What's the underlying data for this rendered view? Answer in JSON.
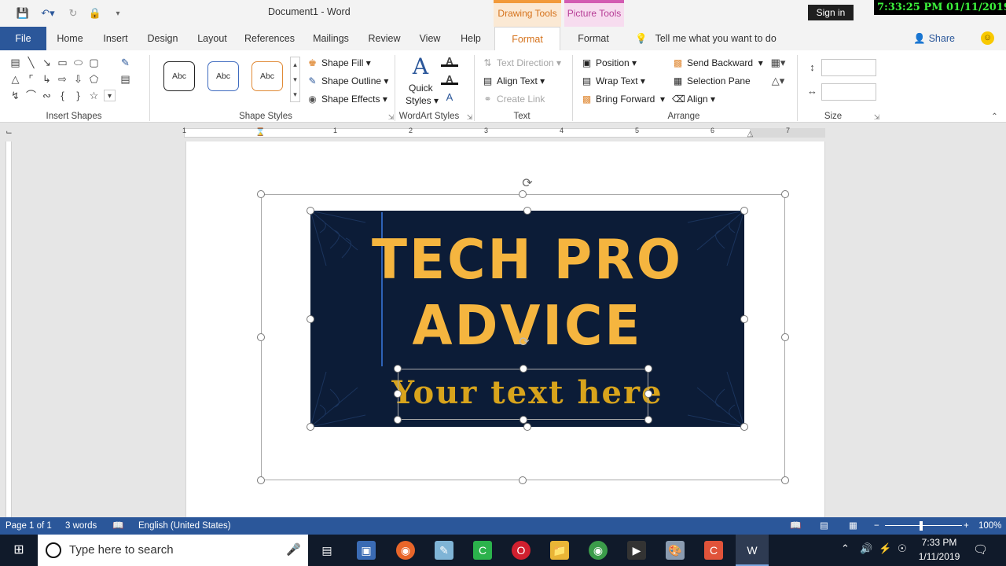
{
  "window": {
    "doc_title": "Document1  -  Word",
    "context_drawing": "Drawing Tools",
    "context_picture": "Picture Tools",
    "signin": "Sign in",
    "clock_overlay": "7:33:25 PM 01/11/2019"
  },
  "tabs": [
    "File",
    "Home",
    "Insert",
    "Design",
    "Layout",
    "References",
    "Mailings",
    "Review",
    "View",
    "Help",
    "Format",
    "Format"
  ],
  "tellme": "Tell me what you want to do",
  "share": "Share",
  "ribbon": {
    "groups": {
      "insert_shapes": "Insert Shapes",
      "shape_styles": "Shape Styles",
      "wordart_styles": "WordArt Styles",
      "text": "Text",
      "arrange": "Arrange",
      "size": "Size"
    },
    "style_sample": "Abc",
    "shape_fill": "Shape Fill",
    "shape_outline": "Shape Outline",
    "shape_effects": "Shape Effects",
    "quick_styles_1": "Quick",
    "quick_styles_2": "Styles",
    "text_direction": "Text Direction",
    "align_text": "Align Text",
    "create_link": "Create Link",
    "position": "Position",
    "wrap_text": "Wrap Text",
    "bring_forward": "Bring Forward",
    "send_backward": "Send Backward",
    "selection_pane": "Selection Pane",
    "align": "Align"
  },
  "ruler": [
    "1",
    "1",
    "2",
    "3",
    "4",
    "5",
    "6",
    "7"
  ],
  "banner": {
    "title_line1": "TECH PRO",
    "title_line2": "ADVICE",
    "subtitle": "Your text here"
  },
  "status": {
    "page": "Page 1 of 1",
    "words": "3 words",
    "language": "English (United States)",
    "zoom": "100%"
  },
  "taskbar": {
    "search_placeholder": "Type here to search",
    "time": "7:33 PM",
    "date": "1/11/2019"
  },
  "colors": {
    "word_blue": "#2b579a",
    "banner_bg": "#0c1c37",
    "banner_text": "#f5b53f",
    "drawing_tools": "#f29a3a",
    "picture_tools": "#d35bb2"
  }
}
